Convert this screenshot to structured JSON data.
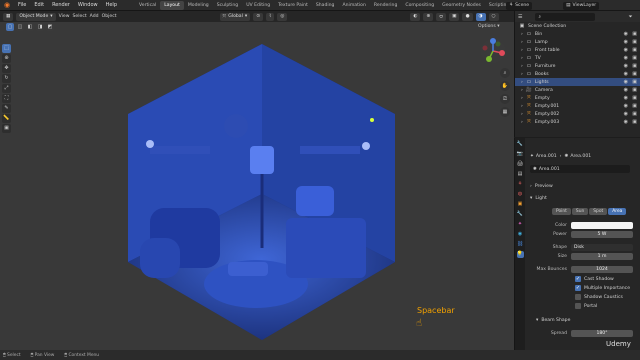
{
  "topbar": {
    "menus": [
      "File",
      "Edit",
      "Render",
      "Window",
      "Help"
    ],
    "workspaces": [
      "Vertical",
      "Layout",
      "Modeling",
      "Sculpting",
      "UV Editing",
      "Texture Paint",
      "Shading",
      "Animation",
      "Rendering",
      "Compositing",
      "Geometry Nodes",
      "Scripting"
    ],
    "active_workspace": "Layout",
    "scene": "Scene",
    "view_layer": "ViewLayer"
  },
  "viewport": {
    "mode": "Object Mode",
    "menus": [
      "View",
      "Select",
      "Add",
      "Object"
    ],
    "transform": "Global",
    "options_label": "Options",
    "overlay_text": "Spacebar"
  },
  "outliner": {
    "root": "Scene Collection",
    "items": [
      {
        "name": "Bin",
        "icon": "collection-icon"
      },
      {
        "name": "Lamp",
        "icon": "collection-icon"
      },
      {
        "name": "Front table",
        "icon": "collection-icon"
      },
      {
        "name": "TV",
        "icon": "collection-icon"
      },
      {
        "name": "Furniture",
        "icon": "collection-icon"
      },
      {
        "name": "Books",
        "icon": "collection-icon"
      },
      {
        "name": "Lights",
        "icon": "collection-icon",
        "selected": true
      },
      {
        "name": "Camera",
        "icon": "camera-icon"
      },
      {
        "name": "Empty",
        "icon": "empty-icon"
      },
      {
        "name": "Empty.001",
        "icon": "empty-icon"
      },
      {
        "name": "Empty.002",
        "icon": "empty-icon"
      },
      {
        "name": "Empty.003",
        "icon": "empty-icon"
      }
    ]
  },
  "properties": {
    "breadcrumb_a": "Area.001",
    "breadcrumb_b": "Area.001",
    "datablock": "Area.001",
    "preview": "Preview",
    "section": "Light",
    "light_types": [
      "Point",
      "Sun",
      "Spot",
      "Area"
    ],
    "active_light_type": "Area",
    "color_label": "Color",
    "power_label": "Power",
    "power_value": "5 W",
    "shape_label": "Shape",
    "shape_value": "Disk",
    "size_label": "Size",
    "size_value": "1 m",
    "max_bounces_label": "Max Bounces",
    "max_bounces_value": "1024",
    "cast_shadow": "Cast Shadow",
    "multiple_importance": "Multiple Importance",
    "shadow_caustics": "Shadow Caustics",
    "portal": "Portal",
    "beam_shape": "Beam Shape",
    "spread_label": "Spread",
    "spread_value": "180°"
  },
  "statusbar": {
    "items": [
      "Select",
      "Pan View",
      "Context Menu"
    ]
  },
  "watermark": "Udemy",
  "colors": {
    "accent": "#4772b3",
    "orange": "#f5792a",
    "scene_blue": "#2b4aa8"
  }
}
